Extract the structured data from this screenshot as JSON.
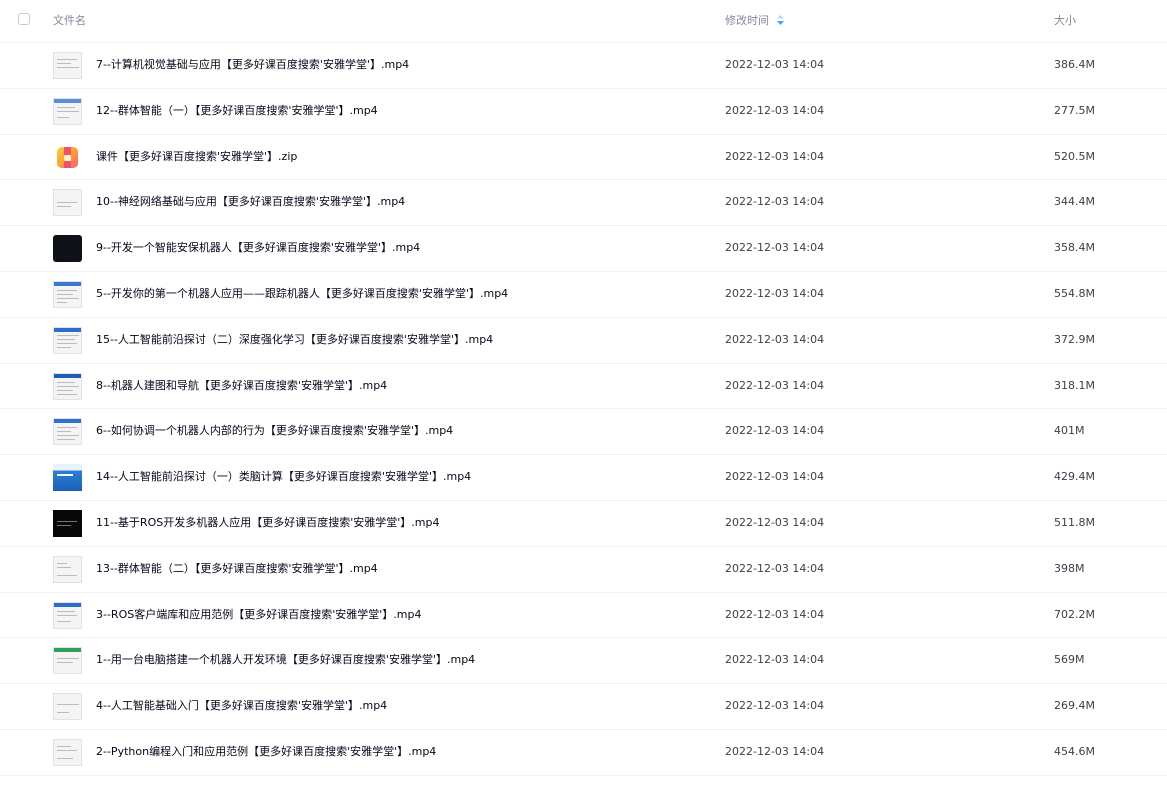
{
  "header": {
    "col_name": "文件名",
    "col_time": "修改时间",
    "col_size": "大小"
  },
  "colors": {
    "sort_active": "#3fa6ff",
    "divider": "#f1f2f4",
    "header_text": "#818999"
  },
  "files": [
    {
      "name": "7--计算机视觉基础与应用【更多好课百度搜索'安雅学堂'】.mp4",
      "time": "2022-12-03 14:04",
      "size": "386.4M",
      "thumb": "video-slide-thumbnail"
    },
    {
      "name": "12--群体智能（一）【更多好课百度搜索'安雅学堂'】.mp4",
      "time": "2022-12-03 14:04",
      "size": "277.5M",
      "thumb": "video-slide-thumbnail"
    },
    {
      "name": "课件【更多好课百度搜索'安雅学堂'】.zip",
      "time": "2022-12-03 14:04",
      "size": "520.5M",
      "thumb": "zip-archive-icon"
    },
    {
      "name": "10--神经网络基础与应用【更多好课百度搜索'安雅学堂'】.mp4",
      "time": "2022-12-03 14:04",
      "size": "344.4M",
      "thumb": "video-slide-thumbnail"
    },
    {
      "name": "9--开发一个智能安保机器人【更多好课百度搜索'安雅学堂'】.mp4",
      "time": "2022-12-03 14:04",
      "size": "358.4M",
      "thumb": "video-dark-thumbnail"
    },
    {
      "name": "5--开发你的第一个机器人应用——跟踪机器人【更多好课百度搜索'安雅学堂'】.mp4",
      "time": "2022-12-03 14:04",
      "size": "554.8M",
      "thumb": "video-slide-thumbnail"
    },
    {
      "name": "15--人工智能前沿探讨（二）深度强化学习【更多好课百度搜索'安雅学堂'】.mp4",
      "time": "2022-12-03 14:04",
      "size": "372.9M",
      "thumb": "video-slide-thumbnail"
    },
    {
      "name": "8--机器人建图和导航【更多好课百度搜索'安雅学堂'】.mp4",
      "time": "2022-12-03 14:04",
      "size": "318.1M",
      "thumb": "video-slide-thumbnail"
    },
    {
      "name": "6--如何协调一个机器人内部的行为【更多好课百度搜索'安雅学堂'】.mp4",
      "time": "2022-12-03 14:04",
      "size": "401M",
      "thumb": "video-slide-thumbnail"
    },
    {
      "name": "14--人工智能前沿探讨（一）类脑计算【更多好课百度搜索'安雅学堂'】.mp4",
      "time": "2022-12-03 14:04",
      "size": "429.4M",
      "thumb": "video-blue-thumbnail"
    },
    {
      "name": "11--基于ROS开发多机器人应用【更多好课百度搜索'安雅学堂'】.mp4",
      "time": "2022-12-03 14:04",
      "size": "511.8M",
      "thumb": "video-black-thumbnail"
    },
    {
      "name": "13--群体智能（二）【更多好课百度搜索'安雅学堂'】.mp4",
      "time": "2022-12-03 14:04",
      "size": "398M",
      "thumb": "video-slide-thumbnail"
    },
    {
      "name": "3--ROS客户端库和应用范例【更多好课百度搜索'安雅学堂'】.mp4",
      "time": "2022-12-03 14:04",
      "size": "702.2M",
      "thumb": "video-slide-thumbnail"
    },
    {
      "name": "1--用一台电脑搭建一个机器人开发环境【更多好课百度搜索'安雅学堂'】.mp4",
      "time": "2022-12-03 14:04",
      "size": "569M",
      "thumb": "video-slide-thumbnail"
    },
    {
      "name": "4--人工智能基础入门【更多好课百度搜索'安雅学堂'】.mp4",
      "time": "2022-12-03 14:04",
      "size": "269.4M",
      "thumb": "video-slide-thumbnail"
    },
    {
      "name": "2--Python编程入门和应用范例【更多好课百度搜索'安雅学堂'】.mp4",
      "time": "2022-12-03 14:04",
      "size": "454.6M",
      "thumb": "video-slide-thumbnail"
    }
  ]
}
